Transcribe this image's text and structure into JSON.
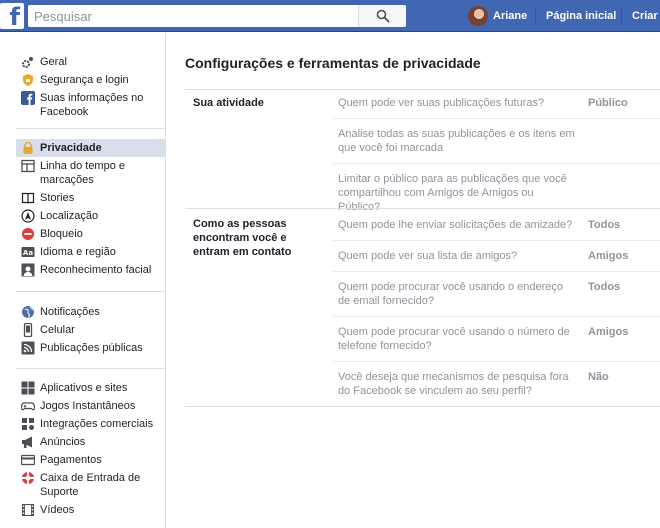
{
  "topbar": {
    "logo": "f",
    "search_placeholder": "Pesquisar",
    "user_name": "Ariane",
    "home_label": "Página inicial",
    "create_label": "Criar"
  },
  "sidebar": {
    "groups": [
      [
        {
          "label": "Geral",
          "icon": "gears-icon"
        },
        {
          "label": "Segurança e login",
          "icon": "shield-icon"
        },
        {
          "label": "Suas informações no Facebook",
          "icon": "facebook-icon"
        }
      ],
      [
        {
          "label": "Privacidade",
          "icon": "lock-icon",
          "active": true
        },
        {
          "label": "Linha do tempo e marcações",
          "icon": "timeline-icon"
        },
        {
          "label": "Stories",
          "icon": "book-icon"
        },
        {
          "label": "Localização",
          "icon": "location-icon"
        },
        {
          "label": "Bloqueio",
          "icon": "block-icon"
        },
        {
          "label": "Idioma e região",
          "icon": "language-icon"
        },
        {
          "label": "Reconhecimento facial",
          "icon": "face-recognition-icon"
        }
      ],
      [
        {
          "label": "Notificações",
          "icon": "globe-icon"
        },
        {
          "label": "Celular",
          "icon": "phone-icon"
        },
        {
          "label": "Publicações públicas",
          "icon": "rss-icon"
        }
      ],
      [
        {
          "label": "Aplicativos e sites",
          "icon": "apps-icon"
        },
        {
          "label": "Jogos Instantâneos",
          "icon": "gamepad-icon"
        },
        {
          "label": "Integrações comerciais",
          "icon": "business-icon"
        },
        {
          "label": "Anúncios",
          "icon": "megaphone-icon"
        },
        {
          "label": "Pagamentos",
          "icon": "card-icon"
        },
        {
          "label": "Caixa de Entrada de Suporte",
          "icon": "lifebuoy-icon"
        },
        {
          "label": "Vídeos",
          "icon": "film-icon"
        }
      ]
    ]
  },
  "main": {
    "title": "Configurações e ferramentas de privacidade",
    "sections": [
      {
        "label": "Sua atividade",
        "rows": [
          {
            "question": "Quem pode ver suas publicações futuras?",
            "value": "Público"
          },
          {
            "question": "Analise todas as suas publicações e os itens em que você foi marcada",
            "value": ""
          },
          {
            "question": "Limitar o público para as publicações que você compartilhou com Amigos de Amigos ou Público?",
            "value": ""
          }
        ]
      },
      {
        "label": "Como as pessoas encontram você e entram em contato",
        "rows": [
          {
            "question": "Quem pode lhe enviar solicitações de amizade?",
            "value": "Todos"
          },
          {
            "question": "Quem pode ver sua lista de amigos?",
            "value": "Amigos"
          },
          {
            "question": "Quem pode procurar você usando o endereço de email fornecido?",
            "value": "Todos"
          },
          {
            "question": "Quem pode procurar você usando o número de telefone fornecido?",
            "value": "Amigos"
          },
          {
            "question": "Você deseja que mecanismos de pesquisa fora do Facebook se vinculem ao seu perfil?",
            "value": "Não"
          }
        ]
      }
    ]
  }
}
